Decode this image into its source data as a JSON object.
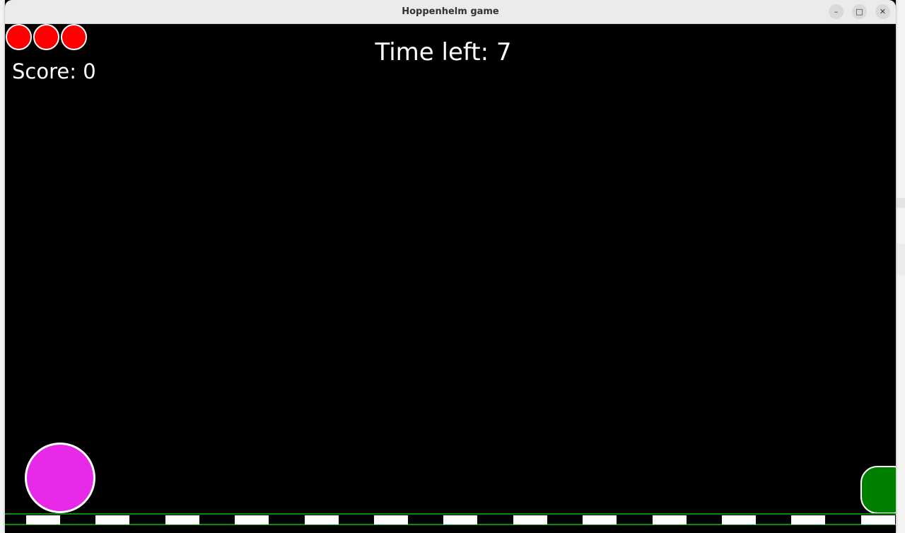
{
  "window": {
    "title": "Hoppenhelm game",
    "controls": {
      "minimize_glyph": "–",
      "maximize_glyph": "□",
      "close_glyph": "✕"
    }
  },
  "hud": {
    "lives": 3,
    "score_text": "Score: 0",
    "time_left_text": "Time left: 7"
  },
  "colors": {
    "background": "#000000",
    "life": "#ff0000",
    "player": "#e62ae8",
    "goal": "#008000",
    "ground_border": "#0a8a0a",
    "ground_tile": "#ffffff"
  },
  "entities": {
    "player": "magenta-ball",
    "goal": "green-block"
  }
}
